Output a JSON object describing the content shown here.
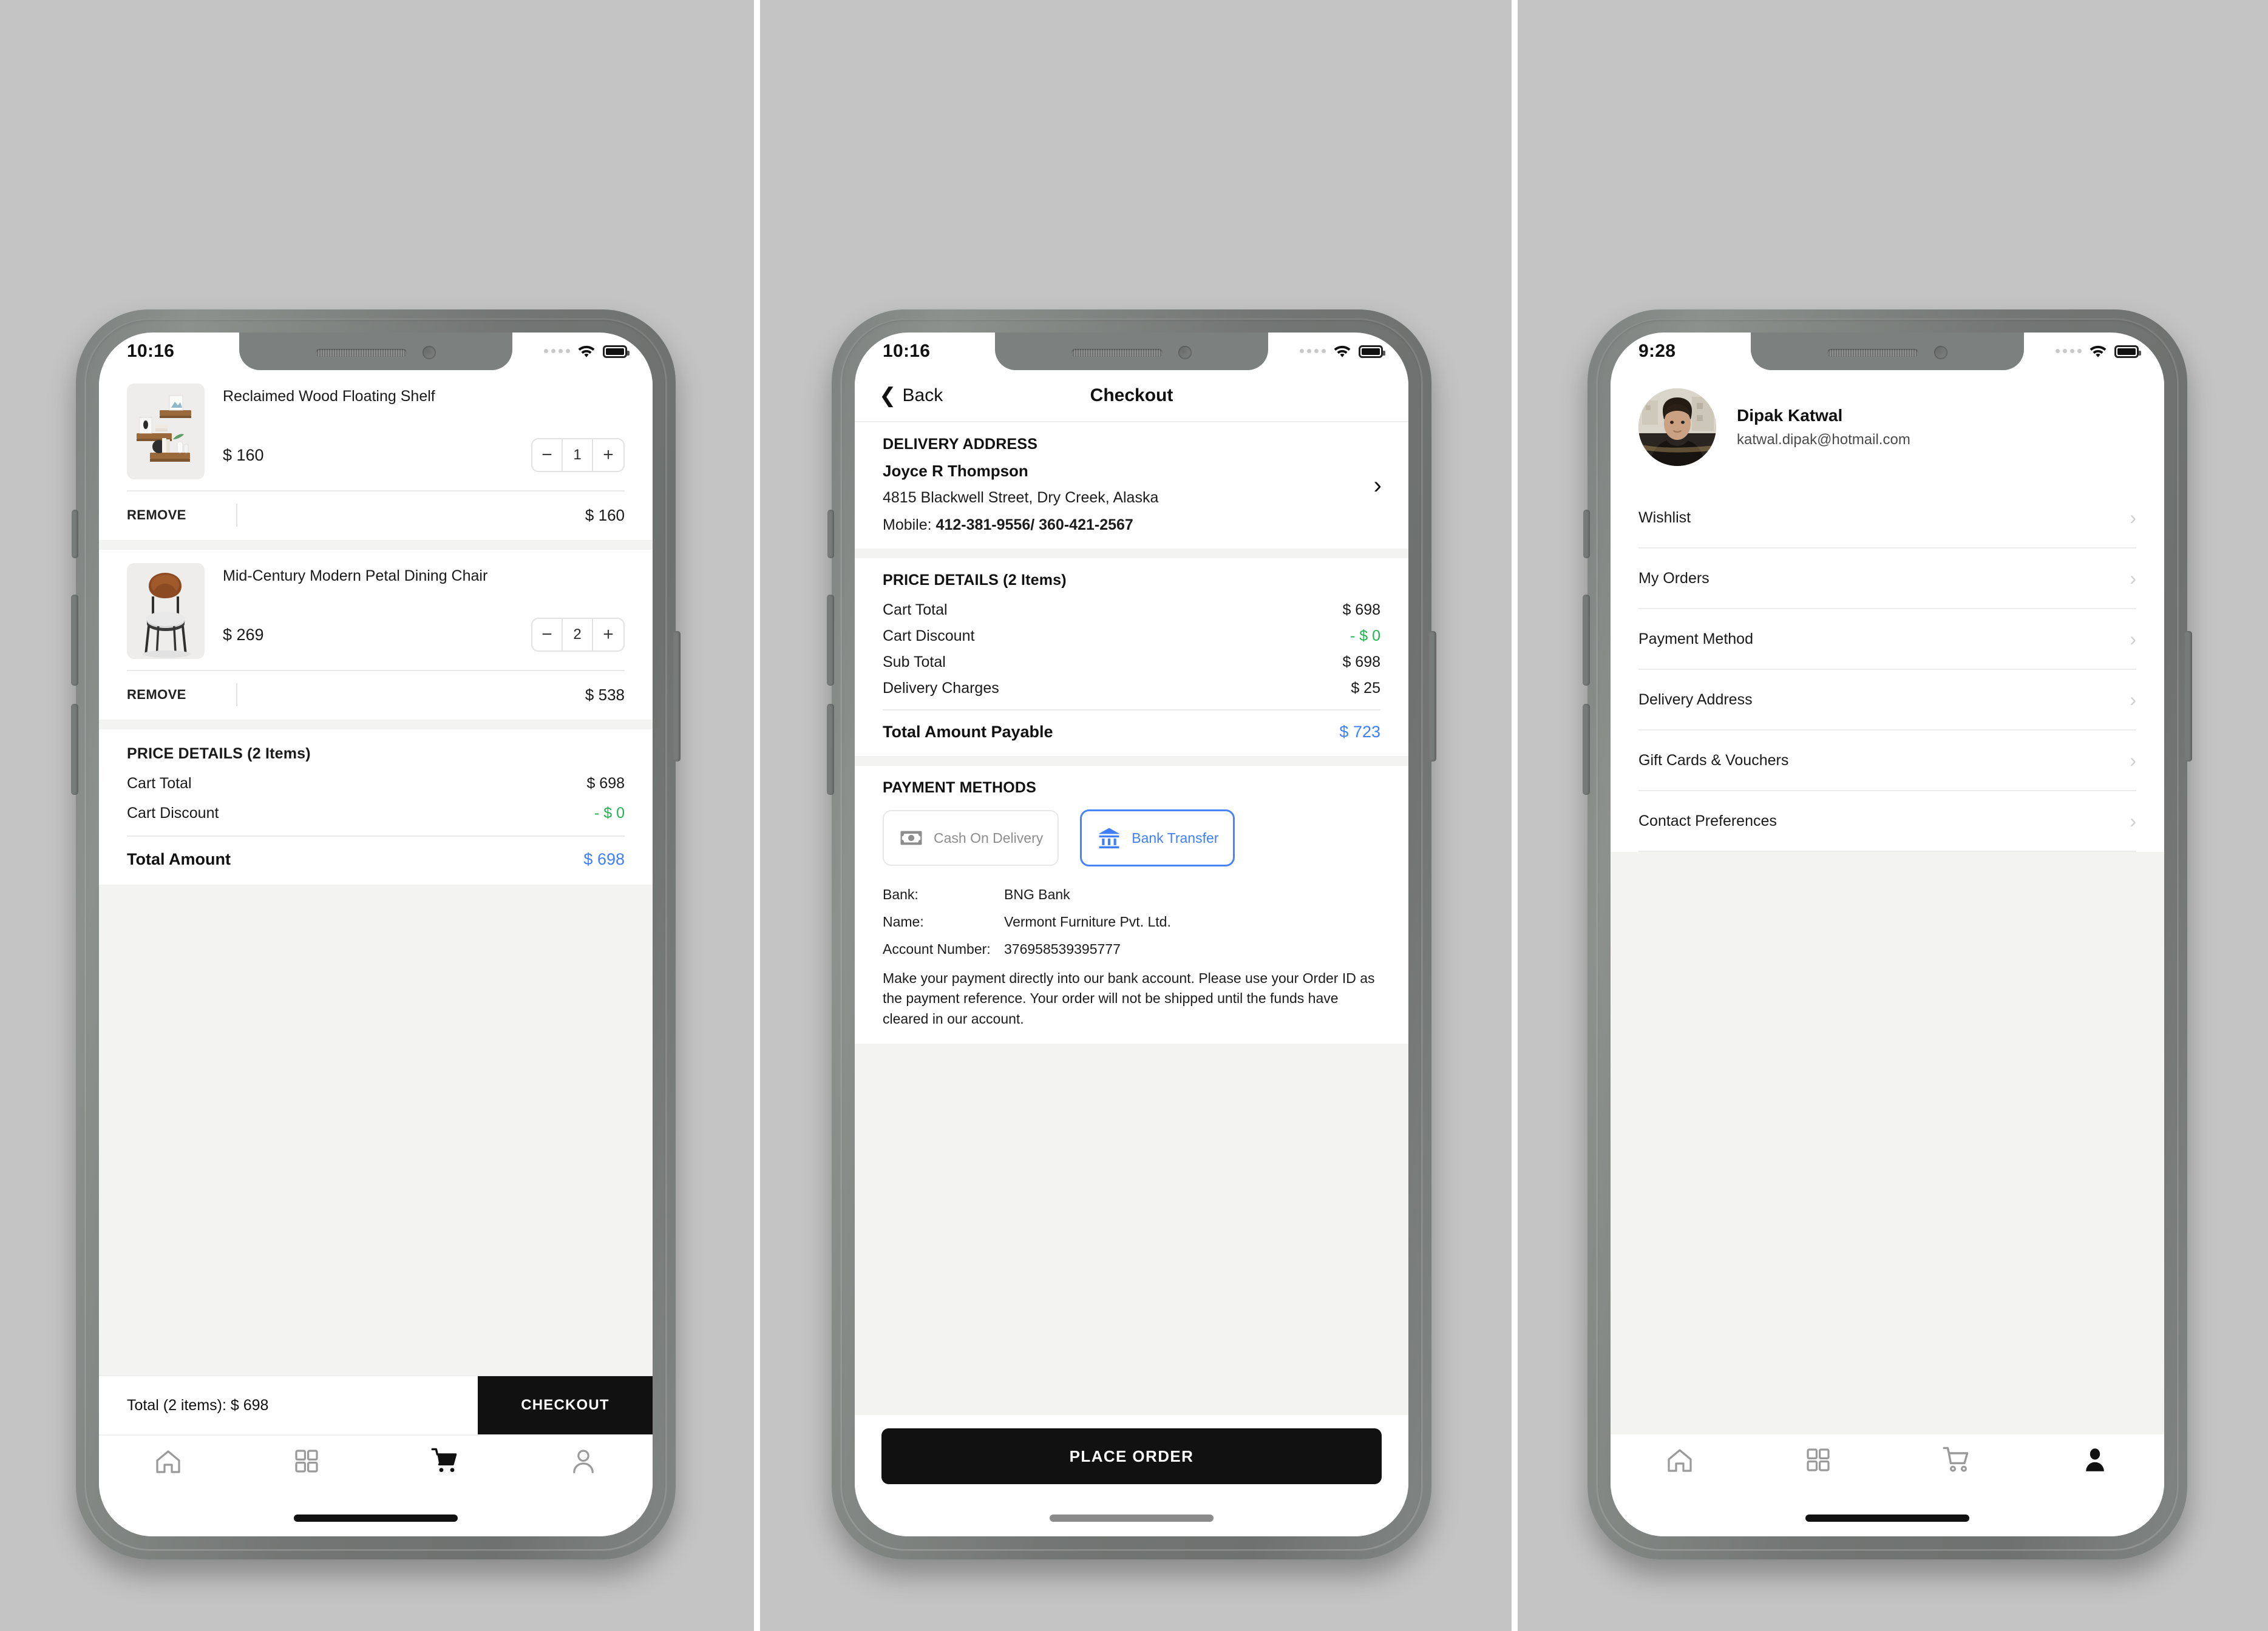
{
  "phone1": {
    "status": {
      "time": "10:16",
      "wifi_icon": "wifi-icon",
      "battery_icon": "battery-icon",
      "signal_icon": "signal-dots-icon"
    },
    "cart_items": [
      {
        "title": "Reclaimed Wood Floating Shelf",
        "price": "$ 160",
        "qty": "1",
        "minus": "−",
        "plus": "+",
        "remove_label": "REMOVE",
        "line_total": "$ 160",
        "image_alt": "reclaimed-wood-floating-shelf-photo"
      },
      {
        "title": "Mid-Century Modern Petal Dining Chair",
        "price": "$ 269",
        "qty": "2",
        "minus": "−",
        "plus": "+",
        "remove_label": "REMOVE",
        "line_total": "$ 538",
        "image_alt": "mid-century-petal-dining-chair-photo"
      }
    ],
    "price_details": {
      "heading": "PRICE DETAILS (2 Items)",
      "rows": [
        {
          "label": "Cart Total",
          "value": "$ 698",
          "color": "default"
        },
        {
          "label": "Cart Discount",
          "value": "- $ 0",
          "color": "green"
        }
      ],
      "total_label": "Total Amount",
      "total_value": "$ 698"
    },
    "footer": {
      "total_text": "Total (2 items): $ 698",
      "checkout_label": "CHECKOUT"
    },
    "nav": [
      {
        "icon": "home-icon",
        "active": false
      },
      {
        "icon": "grid-categories-icon",
        "active": false
      },
      {
        "icon": "cart-icon",
        "active": true
      },
      {
        "icon": "user-profile-icon",
        "active": false
      }
    ]
  },
  "phone2": {
    "status": {
      "time": "10:16",
      "wifi_icon": "wifi-icon",
      "battery_icon": "battery-icon",
      "signal_icon": "signal-dots-icon"
    },
    "navbar": {
      "back_label": "Back",
      "back_icon": "chevron-left-icon",
      "title": "Checkout"
    },
    "delivery": {
      "heading": "DELIVERY ADDRESS",
      "name": "Joyce R Thompson",
      "address": "4815  Blackwell Street, Dry Creek, Alaska",
      "mobile_label": "Mobile: ",
      "mobile_value": "412-381-9556/ 360-421-2567",
      "chevron": "›"
    },
    "price_details": {
      "heading": "PRICE DETAILS (2 Items)",
      "rows": [
        {
          "label": "Cart Total",
          "value": "$ 698",
          "color": "default"
        },
        {
          "label": "Cart Discount",
          "value": "- $ 0",
          "color": "green"
        },
        {
          "label": "Sub Total",
          "value": "$ 698",
          "color": "default"
        },
        {
          "label": "Delivery Charges",
          "value": "$ 25",
          "color": "default"
        }
      ],
      "total_label": "Total Amount Payable",
      "total_value": "$ 723"
    },
    "payment": {
      "heading": "PAYMENT METHODS",
      "methods": [
        {
          "label": "Cash On Delivery",
          "icon": "cash-banknote-icon",
          "selected": false
        },
        {
          "label": "Bank Transfer",
          "icon": "bank-building-icon",
          "selected": true
        }
      ],
      "bank_rows": [
        {
          "key": "Bank:",
          "value": "BNG Bank"
        },
        {
          "key": "Name:",
          "value": "Vermont Furniture Pvt. Ltd."
        },
        {
          "key": "Account Number:",
          "value": "376958539395777"
        }
      ],
      "note": "Make your payment directly into our bank account. Please use your Order ID as the payment reference. Your order will not be shipped until the funds have cleared in our account."
    },
    "place_order_label": "PLACE ORDER"
  },
  "phone3": {
    "status": {
      "time": "9:28",
      "wifi_icon": "wifi-icon",
      "battery_icon": "battery-icon",
      "signal_icon": "signal-dots-icon"
    },
    "profile": {
      "name": "Dipak Katwal",
      "email": "katwal.dipak@hotmail.com",
      "avatar_alt": "user-avatar-photo"
    },
    "menu_items": [
      {
        "label": "Wishlist",
        "chevron": "›"
      },
      {
        "label": "My Orders",
        "chevron": "›"
      },
      {
        "label": "Payment Method",
        "chevron": "›"
      },
      {
        "label": "Delivery Address",
        "chevron": "›"
      },
      {
        "label": "Gift Cards & Vouchers",
        "chevron": "›"
      },
      {
        "label": "Contact Preferences",
        "chevron": "›"
      }
    ],
    "nav": [
      {
        "icon": "home-icon",
        "active": false
      },
      {
        "icon": "grid-categories-icon",
        "active": false
      },
      {
        "icon": "cart-icon",
        "active": false
      },
      {
        "icon": "user-profile-icon",
        "active": true
      }
    ]
  },
  "colors": {
    "accent_blue": "#3f7fff",
    "discount_green": "#22b352",
    "dark_button": "#111111",
    "page_background": "#c4c4c4",
    "muted_gray": "#8d8d8d"
  }
}
